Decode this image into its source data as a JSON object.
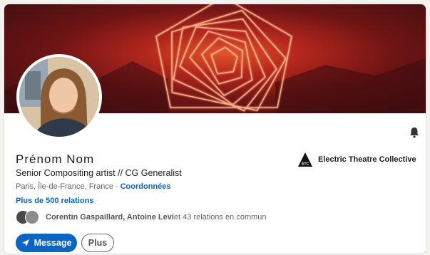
{
  "profile": {
    "name": "Prénom Nom",
    "headline": "Senior Compositing artist // CG Generalist",
    "location": "Paris, Île-de-France, France",
    "separator": "·",
    "contact_link": "Coordonnées",
    "relations": "Plus de 500 relations",
    "mutual": {
      "names": "Corentin Gaspaillard, Antoine Levi",
      "rest": " et 43 relations en commun"
    }
  },
  "company": {
    "name": "Electric Theatre Collective",
    "logo_text": "ETC"
  },
  "actions": {
    "message_label": "Message",
    "more_label": "Plus"
  },
  "icons": {
    "bell": "bell-icon",
    "message": "paper-plane-icon"
  },
  "colors": {
    "accent": "#0a66c2",
    "banner_primary": "#b3261d",
    "banner_glow": "#ffb38a"
  }
}
